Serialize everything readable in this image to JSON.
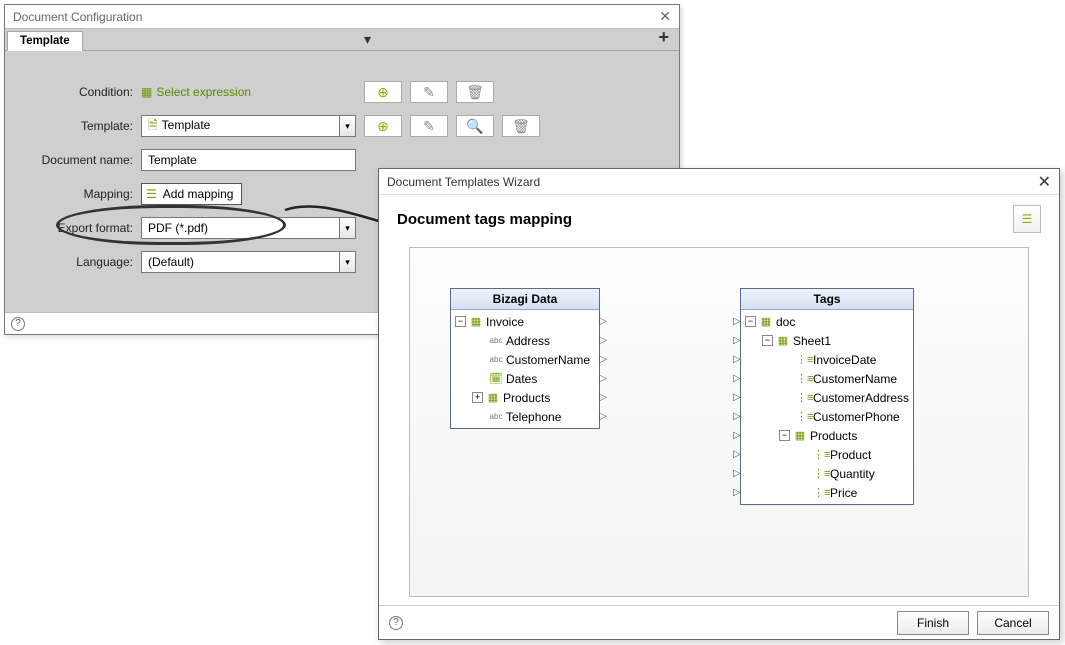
{
  "config_window": {
    "title": "Document Configuration",
    "tab": "Template",
    "rows": {
      "condition_label": "Condition:",
      "condition_value": "Select expression",
      "template_label": "Template:",
      "template_value": "Template",
      "docname_label": "Document name:",
      "docname_value": "Template",
      "mapping_label": "Mapping:",
      "mapping_value": "Add mapping",
      "export_label": "Export format:",
      "export_value": "PDF (*.pdf)",
      "language_label": "Language:",
      "language_value": "(Default)"
    }
  },
  "wizard_window": {
    "title": "Document Templates Wizard",
    "heading": "Document tags mapping",
    "finish": "Finish",
    "cancel": "Cancel",
    "left_tree": {
      "header": "Bizagi Data",
      "nodes": [
        {
          "depth": 0,
          "exp": "-",
          "ico": "entity",
          "label": "Invoice",
          "out": true
        },
        {
          "depth": 1,
          "exp": "",
          "ico": "abc",
          "label": "Address",
          "out": true
        },
        {
          "depth": 1,
          "exp": "",
          "ico": "abc",
          "label": "CustomerName",
          "out": true
        },
        {
          "depth": 1,
          "exp": "",
          "ico": "date",
          "label": "Dates",
          "out": true
        },
        {
          "depth": 1,
          "exp": "+",
          "ico": "entity",
          "label": "Products",
          "out": true
        },
        {
          "depth": 1,
          "exp": "",
          "ico": "abc",
          "label": "Telephone",
          "out": true
        }
      ]
    },
    "right_tree": {
      "header": "Tags",
      "nodes": [
        {
          "depth": 0,
          "exp": "-",
          "ico": "entity",
          "label": "doc",
          "in": true
        },
        {
          "depth": 1,
          "exp": "-",
          "ico": "entity",
          "label": "Sheet1",
          "in": true
        },
        {
          "depth": 2,
          "exp": "",
          "ico": "tag",
          "label": "InvoiceDate",
          "in": true
        },
        {
          "depth": 2,
          "exp": "",
          "ico": "tag",
          "label": "CustomerName",
          "in": true
        },
        {
          "depth": 2,
          "exp": "",
          "ico": "tag",
          "label": "CustomerAddress",
          "in": true
        },
        {
          "depth": 2,
          "exp": "",
          "ico": "tag",
          "label": "CustomerPhone",
          "in": true
        },
        {
          "depth": 2,
          "exp": "-",
          "ico": "entity",
          "label": "Products",
          "in": true
        },
        {
          "depth": 3,
          "exp": "",
          "ico": "tag",
          "label": "Product",
          "in": true
        },
        {
          "depth": 3,
          "exp": "",
          "ico": "tag",
          "label": "Quantity",
          "in": true
        },
        {
          "depth": 3,
          "exp": "",
          "ico": "tag",
          "label": "Price",
          "in": true
        }
      ]
    }
  }
}
